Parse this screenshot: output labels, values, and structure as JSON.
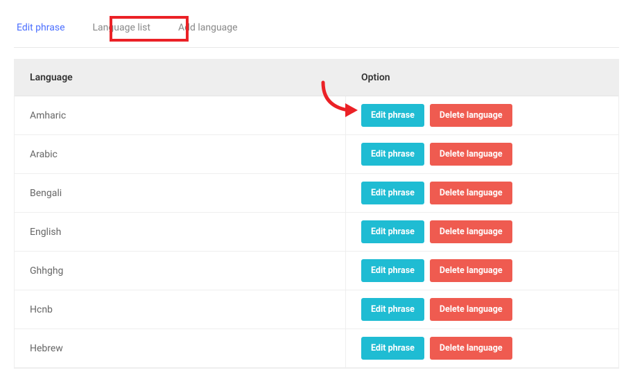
{
  "tabs": {
    "edit_phrase": "Edit phrase",
    "language_list": "Language list",
    "add_language": "Add language"
  },
  "table": {
    "headers": {
      "language": "Language",
      "option": "Option"
    },
    "buttons": {
      "edit": "Edit phrase",
      "delete": "Delete language"
    },
    "rows": [
      {
        "name": "Amharic"
      },
      {
        "name": "Arabic"
      },
      {
        "name": "Bengali"
      },
      {
        "name": "English"
      },
      {
        "name": "Ghhghg"
      },
      {
        "name": "Hcnb"
      },
      {
        "name": "Hebrew"
      }
    ]
  },
  "colors": {
    "highlight_border": "#EB2126",
    "btn_edit": "#1FBCD3",
    "btn_delete": "#EF5B50",
    "tab_active": "#4B6FFF"
  }
}
